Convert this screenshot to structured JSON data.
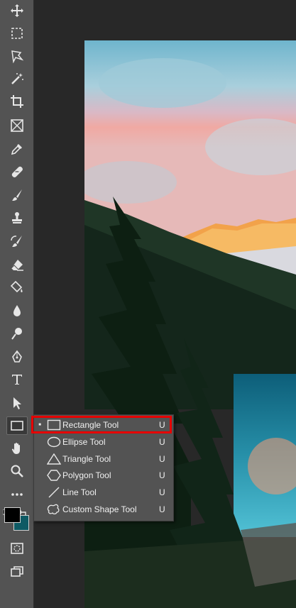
{
  "toolbar": {
    "tools": [
      {
        "name": "move-tool",
        "icon": "move-icon"
      },
      {
        "name": "marquee-tool",
        "icon": "marquee-icon"
      },
      {
        "name": "lasso-tool",
        "icon": "polygonal-lasso-icon"
      },
      {
        "name": "magic-wand-tool",
        "icon": "magic-wand-icon"
      },
      {
        "name": "crop-tool",
        "icon": "crop-icon"
      },
      {
        "name": "frame-tool",
        "icon": "frame-icon"
      },
      {
        "name": "eyedropper-tool",
        "icon": "eyedropper-icon"
      },
      {
        "name": "healing-brush-tool",
        "icon": "bandage-icon"
      },
      {
        "name": "brush-tool",
        "icon": "brush-icon"
      },
      {
        "name": "clone-stamp-tool",
        "icon": "stamp-icon"
      },
      {
        "name": "history-brush-tool",
        "icon": "history-brush-icon"
      },
      {
        "name": "eraser-tool",
        "icon": "eraser-icon"
      },
      {
        "name": "paint-bucket-tool",
        "icon": "paint-bucket-icon"
      },
      {
        "name": "blur-tool",
        "icon": "drop-icon"
      },
      {
        "name": "dodge-tool",
        "icon": "dodge-icon"
      },
      {
        "name": "pen-tool",
        "icon": "pen-icon"
      },
      {
        "name": "type-tool",
        "icon": "type-icon"
      },
      {
        "name": "path-selection-tool",
        "icon": "arrow-pointer-icon"
      },
      {
        "name": "rectangle-tool",
        "icon": "rectangle-icon"
      },
      {
        "name": "hand-tool",
        "icon": "hand-icon"
      },
      {
        "name": "zoom-tool",
        "icon": "zoom-icon"
      },
      {
        "name": "more-tools",
        "icon": "ellipsis-icon"
      }
    ],
    "foreground_color": "#000000",
    "background_color": "#0e5a64"
  },
  "flyout": {
    "items": [
      {
        "label": "Rectangle Tool",
        "key": "U",
        "icon": "rectangle-icon",
        "selected": true
      },
      {
        "label": "Ellipse Tool",
        "key": "U",
        "icon": "ellipse-icon",
        "selected": false
      },
      {
        "label": "Triangle Tool",
        "key": "U",
        "icon": "triangle-icon",
        "selected": false
      },
      {
        "label": "Polygon Tool",
        "key": "U",
        "icon": "polygon-icon",
        "selected": false
      },
      {
        "label": "Line Tool",
        "key": "U",
        "icon": "line-icon",
        "selected": false
      },
      {
        "label": "Custom Shape Tool",
        "key": "U",
        "icon": "custom-shape-icon",
        "selected": false
      }
    ]
  },
  "colors": {
    "highlight": "#e60000",
    "toolbar_bg": "#535353",
    "workspace_bg": "#282828"
  }
}
